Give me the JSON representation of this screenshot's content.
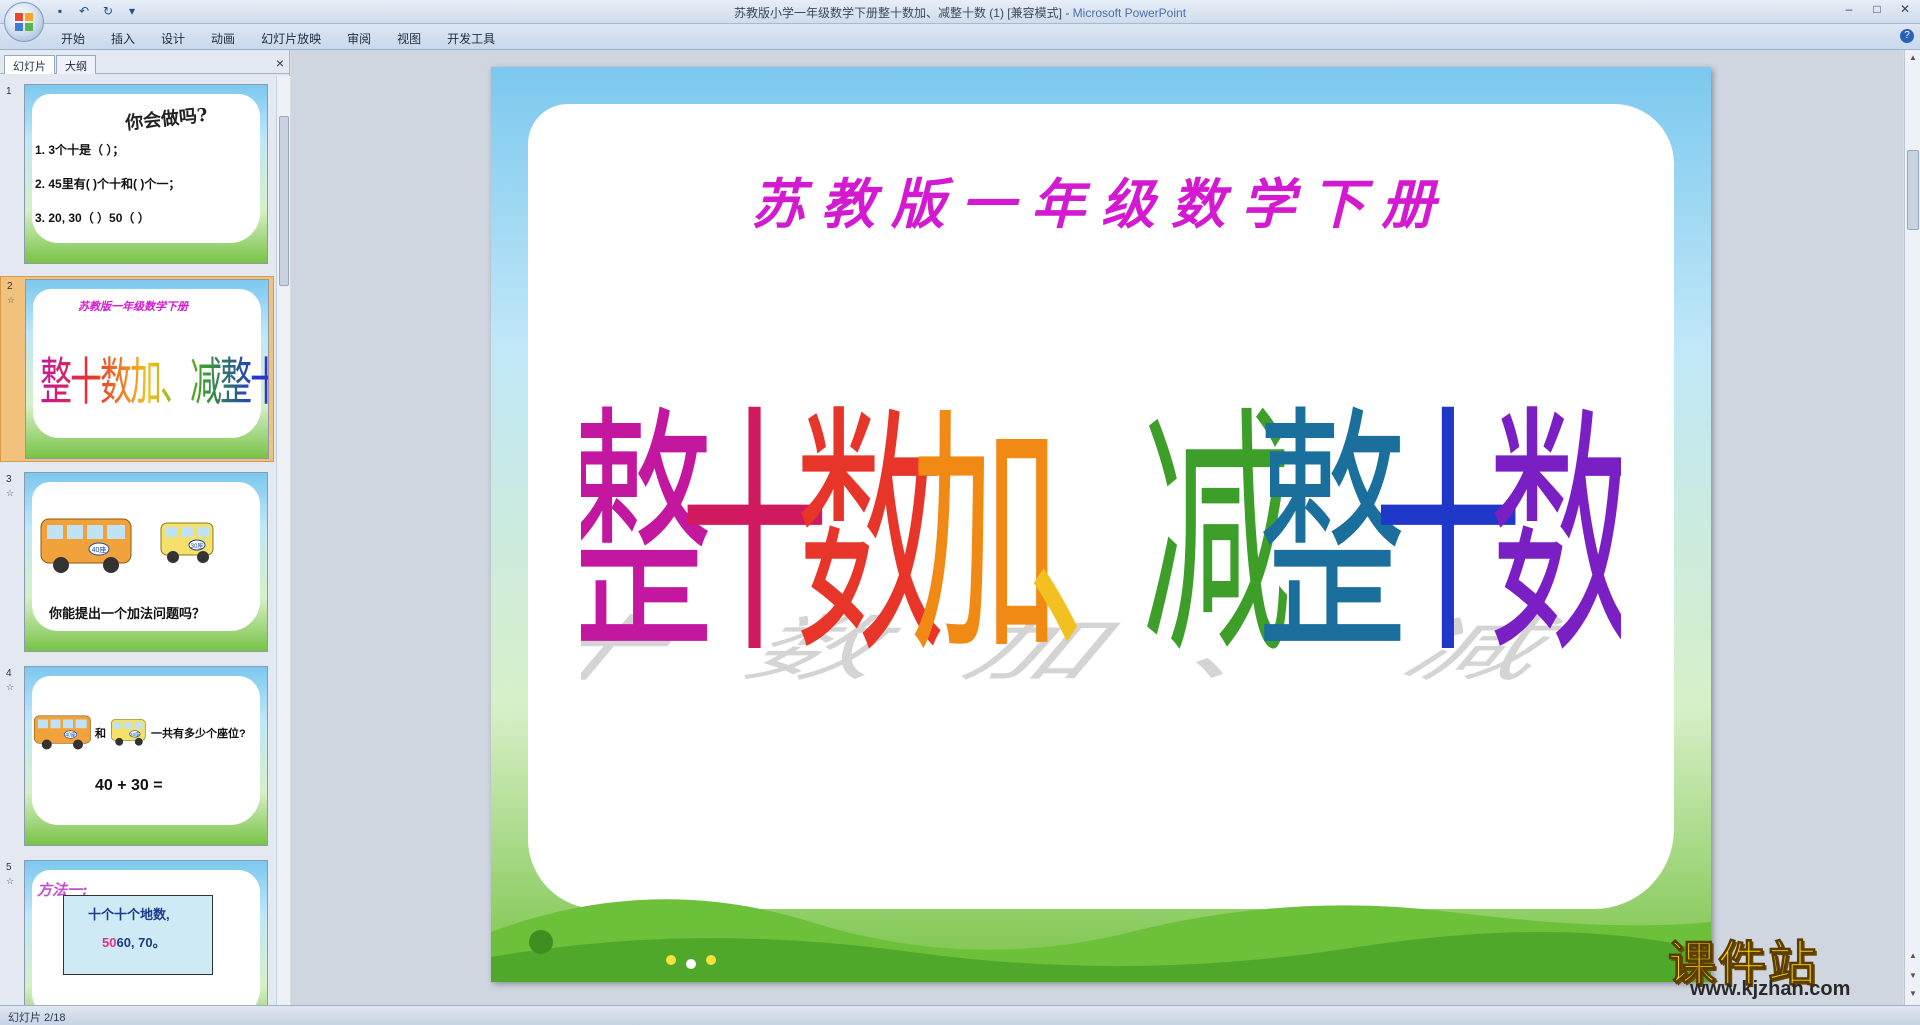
{
  "window": {
    "title": "苏教版小学一年级数学下册整十数加、减整十数 (1) [兼容模式]",
    "app_name": "Microsoft PowerPoint",
    "separator": " - "
  },
  "ribbon": {
    "tabs": [
      "开始",
      "插入",
      "设计",
      "动画",
      "幻灯片放映",
      "审阅",
      "视图",
      "开发工具"
    ]
  },
  "left_pane": {
    "tab_slides": "幻灯片",
    "tab_outline": "大纲",
    "close": "×"
  },
  "thumbnails": [
    {
      "number": "1",
      "title": "你会做吗?",
      "lines": [
        "1. 3个十是（ ）；",
        "2. 45里有(  )个十和(  )个一；",
        "3. 20, 30（   ）50（  ）"
      ]
    },
    {
      "number": "2",
      "star": "☆",
      "subtitle": "苏教版一年级数学下册",
      "title": "整十数加、减整十数"
    },
    {
      "number": "3",
      "star": "☆",
      "bus_big": "40座",
      "bus_small": "30座",
      "question": "你能提出一个加法问题吗？"
    },
    {
      "number": "4",
      "star": "☆",
      "bus_big": "40座",
      "bus_small": "30座",
      "and": "和",
      "question": "一共有多少个座位?",
      "equation": "40 + 30 ="
    },
    {
      "number": "5",
      "star": "☆",
      "method": "方法一:",
      "box_line1": "十个十个地数,",
      "box_prefix": "50",
      "box_line2": "60, 70。"
    }
  ],
  "slide": {
    "subtitle": "苏教版一年级数学下册",
    "title_chars": [
      "整",
      "十",
      "数",
      "加",
      "、",
      "减",
      "整",
      "十",
      "数"
    ],
    "title_colors": [
      "#c2179e",
      "#d1195f",
      "#e8352a",
      "#f08a15",
      "#f2c020",
      "#3d9f2a",
      "#1a6f9c",
      "#2038c9",
      "#7a1fc4"
    ]
  },
  "status": {
    "text": "幻灯片 2/18"
  },
  "watermark": {
    "big": "课件站",
    "small": "www.kjzhan.com"
  }
}
